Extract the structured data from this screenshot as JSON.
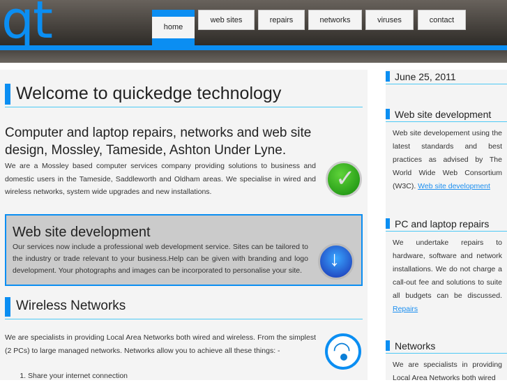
{
  "logo": "qt",
  "nav": [
    "home",
    "web sites",
    "repairs",
    "networks",
    "viruses",
    "contact"
  ],
  "main": {
    "title": "Welcome to quickedge technology",
    "subtitle": "Computer and laptop repairs, networks and web site design, Mossley, Tameside, Ashton Under Lyne.",
    "intro": "We are a Mossley based computer services company providing solutions to business and domestic users in the Tameside, Saddleworth and Oldham areas. We specialise in wired and wireless networks, system wide upgrades and new installations.",
    "box_title": "Web site development",
    "box_text": "Our services now include a professional web development service. Sites can be tailored to the industry or trade relevant to your business.Help can be given with branding and logo development. Your photographs and images can be incorporated to personalise your site.",
    "wireless_title": "Wireless Networks",
    "wireless_text": "We are specialists in providing Local Area Networks both wired and wireless. From the simplest (2 PCs) to large managed networks. Networks allow you to achieve all these things: -",
    "list": [
      "Share your internet connection"
    ]
  },
  "side": {
    "date": "June 25, 2011",
    "s1_title": "Web site development",
    "s1_text": "Web site developement using the latest standards and best practices as advised by The World Wide Web Consortium (W3C). ",
    "s1_link": "Web site development",
    "s2_title": "PC and laptop repairs",
    "s2_text": "We undertake repairs to hardware, software and network installations. We do not charge a call-out fee and solutions to suite all budgets can be discussed. ",
    "s2_link": "Repairs",
    "s3_title": "Networks",
    "s3_text": "We are specialists in providing Local Area Networks both wired"
  }
}
